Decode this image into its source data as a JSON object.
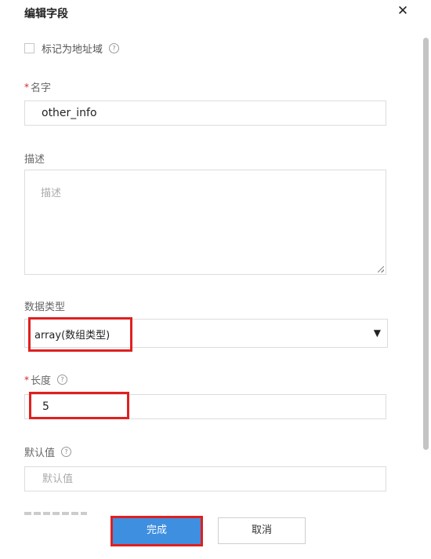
{
  "dialog": {
    "title": "编辑字段",
    "close_symbol": "✕"
  },
  "mark_address": {
    "label": "标记为地址域",
    "checked": false,
    "help_icon": "question-circle-icon"
  },
  "name_field": {
    "required_mark": "*",
    "label": "名字",
    "value": "other_info"
  },
  "description_field": {
    "label": "描述",
    "placeholder": "描述",
    "value": ""
  },
  "data_type_field": {
    "label": "数据类型",
    "selected": "array(数组类型)",
    "arrow": "▼"
  },
  "length_field": {
    "required_mark": "*",
    "label": "长度",
    "value": "5",
    "help_icon": "question-circle-icon"
  },
  "default_value_field": {
    "label": "默认值",
    "placeholder": "默认值",
    "value": "",
    "help_icon": "question-circle-icon"
  },
  "footer": {
    "confirm_label": "完成",
    "cancel_label": "取消"
  },
  "colors": {
    "primary": "#3f8fe0",
    "highlight": "#e02020",
    "required": "#e02020"
  }
}
